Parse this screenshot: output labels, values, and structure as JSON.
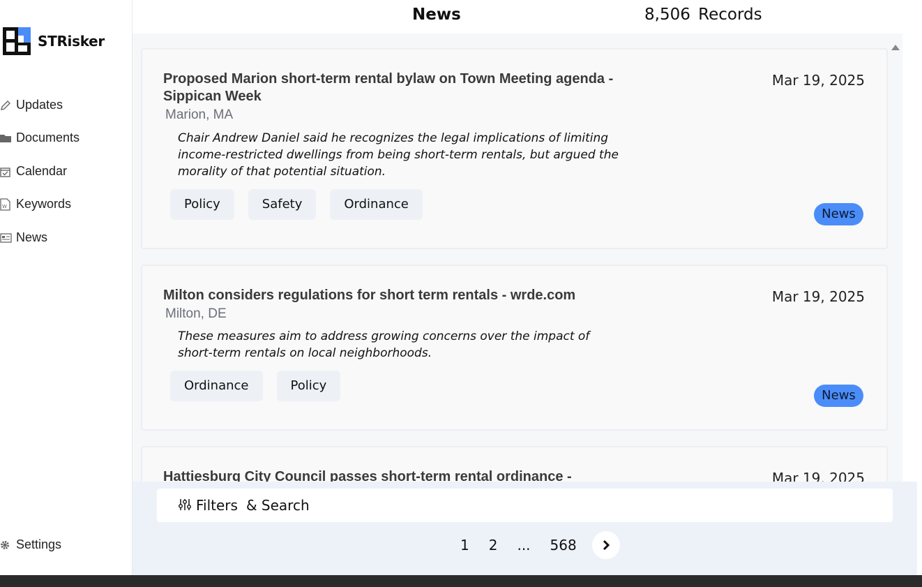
{
  "app": {
    "brand": "STRisker",
    "colors": {
      "accent": "#4b8df8",
      "logo_blue": "#4b8df8",
      "logo_black": "#111111"
    }
  },
  "sidebar": {
    "items": [
      {
        "label": "Updates",
        "icon": "pencil-icon"
      },
      {
        "label": "Documents",
        "icon": "folder-icon"
      },
      {
        "label": "Calendar",
        "icon": "calendar-check-icon"
      },
      {
        "label": "Keywords",
        "icon": "keyword-document-icon"
      },
      {
        "label": "News",
        "icon": "newspaper-icon"
      }
    ],
    "settings": {
      "label": "Settings",
      "icon": "gear-icon"
    }
  },
  "header": {
    "title": "News",
    "count": "8,506",
    "count_label": "Records"
  },
  "articles": [
    {
      "title": "Proposed Marion short-term rental bylaw on Town Meeting agenda - Sippican Week",
      "date": "Mar 19, 2025",
      "location": "Marion, MA",
      "summary": "Chair Andrew Daniel said he recognizes the legal implications of limiting income-restricted dwellings from being short-term rentals, but argued the morality of that potential situation.",
      "tags": [
        "Policy",
        "Safety",
        "Ordinance"
      ],
      "badge": "News"
    },
    {
      "title": "Milton considers regulations for short term rentals - wrde.com",
      "date": "Mar 19, 2025",
      "location": "Milton, DE",
      "summary": "These measures aim to address growing concerns over the impact of short-term rentals on local neighborhoods.",
      "tags": [
        "Ordinance",
        "Policy"
      ],
      "badge": "News"
    },
    {
      "title": "Hattiesburg City Council passes short-term rental ordinance -",
      "date": "Mar 19, 2025"
    }
  ],
  "filters": {
    "label": "Filters",
    "search_label": "& Search",
    "icon": "sliders-icon"
  },
  "pagination": {
    "pages": [
      "1",
      "2",
      "...",
      "568"
    ],
    "next_icon": "chevron-right-icon"
  }
}
